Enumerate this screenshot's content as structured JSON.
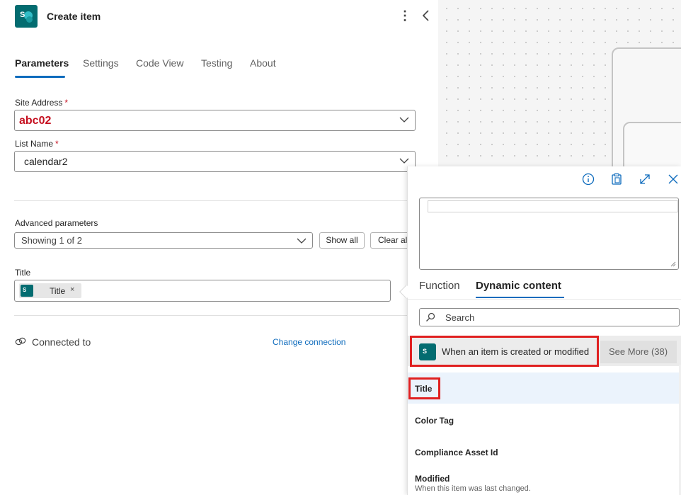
{
  "header": {
    "title": "Create item",
    "more_icon": "more-vertical-icon",
    "collapse_icon": "chevron-left-icon"
  },
  "tabs": [
    {
      "label": "Parameters",
      "active": true
    },
    {
      "label": "Settings",
      "active": false
    },
    {
      "label": "Code View",
      "active": false
    },
    {
      "label": "Testing",
      "active": false
    },
    {
      "label": "About",
      "active": false
    }
  ],
  "fields": {
    "site_address": {
      "label": "Site Address",
      "required": "*",
      "value": "abc02"
    },
    "list_name": {
      "label": "List Name",
      "required": "*",
      "value": "calendar2"
    }
  },
  "advanced": {
    "label": "Advanced parameters",
    "value": "Showing 1 of 2",
    "show_all": "Show all",
    "clear_all": "Clear all"
  },
  "title_field": {
    "label": "Title",
    "token_label": "Title",
    "token_remove": "×"
  },
  "connection": {
    "label": "Connected to",
    "change_label": "Change connection"
  },
  "popup": {
    "tabs": [
      {
        "label": "Function",
        "active": false
      },
      {
        "label": "Dynamic content",
        "active": true
      }
    ],
    "search_placeholder": "Search",
    "group": {
      "name": "When an item is created or modified",
      "see_more": "See More (38)"
    },
    "items": [
      {
        "name": "Title",
        "description": "",
        "selected": true
      },
      {
        "name": "Color Tag",
        "description": "",
        "selected": false
      },
      {
        "name": "Compliance Asset Id",
        "description": "",
        "selected": false
      },
      {
        "name": "Modified",
        "description": "When this item was last changed.",
        "selected": false
      }
    ]
  },
  "colors": {
    "accent": "#0f6cbd",
    "sharepoint": "#036c70",
    "required": "#c50f1f",
    "highlight": "#e02020"
  }
}
